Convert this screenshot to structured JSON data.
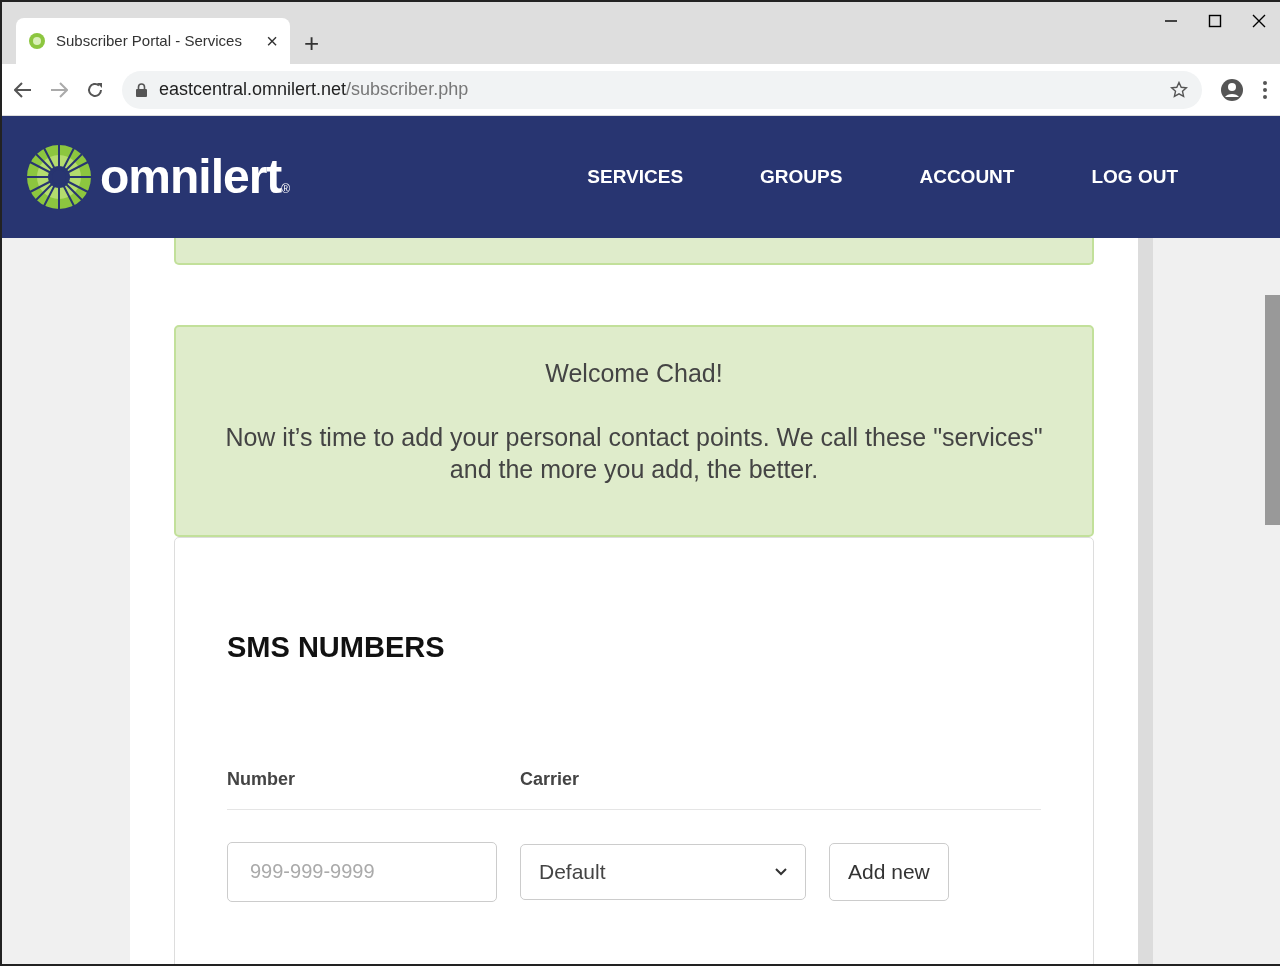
{
  "browser": {
    "tab_title": "Subscriber Portal - Services",
    "tab_close": "×",
    "new_tab": "+",
    "url_host": "eastcentral.omnilert.net",
    "url_path": "/subscriber.php"
  },
  "site": {
    "logo": "omnilert",
    "logo_mark": "®",
    "nav": [
      {
        "label": "SERVICES"
      },
      {
        "label": "GROUPS"
      },
      {
        "label": "ACCOUNT"
      },
      {
        "label": "LOG OUT"
      }
    ]
  },
  "welcome": {
    "title": "Welcome Chad!",
    "message": "Now it’s time to add your personal contact points. We call these \"services\" and the more you add, the better."
  },
  "sms": {
    "heading": "SMS NUMBERS",
    "columns": [
      "Number",
      "Carrier"
    ],
    "number": {
      "placeholder": "999-999-9999"
    },
    "carrier": {
      "value": "Default"
    },
    "add_button": "Add new"
  }
}
